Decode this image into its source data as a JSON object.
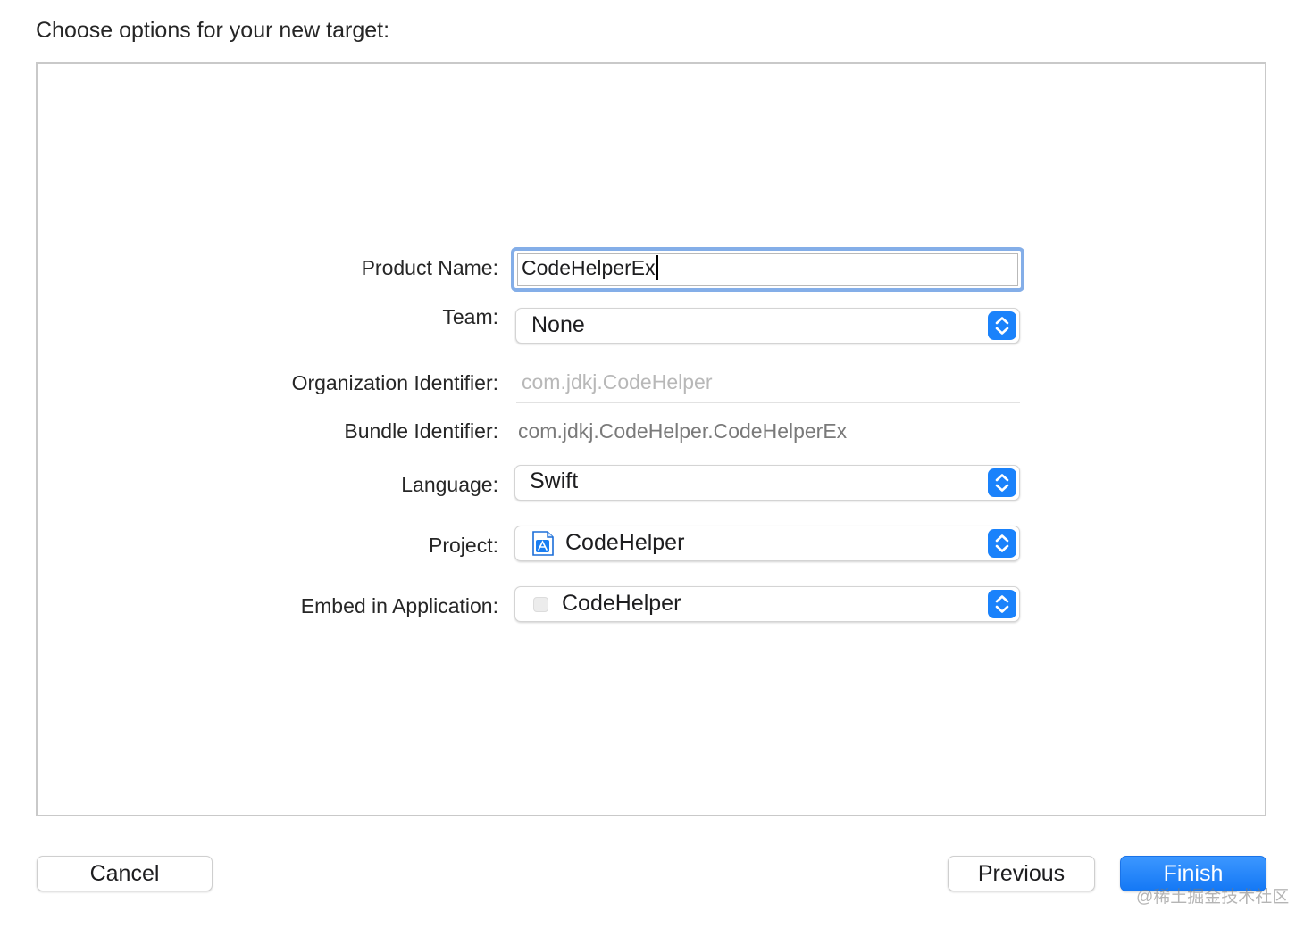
{
  "dialog": {
    "heading": "Choose options for your new target:"
  },
  "form": {
    "product_name": {
      "label": "Product Name:",
      "value": "CodeHelperEx"
    },
    "team": {
      "label": "Team:",
      "value": "None"
    },
    "organization_identifier": {
      "label": "Organization Identifier:",
      "placeholder": "com.jdkj.CodeHelper"
    },
    "bundle_identifier": {
      "label": "Bundle Identifier:",
      "value": "com.jdkj.CodeHelper.CodeHelperEx"
    },
    "language": {
      "label": "Language:",
      "value": "Swift"
    },
    "project": {
      "label": "Project:",
      "value": "CodeHelper",
      "icon": "xcode-project-icon"
    },
    "embed_in_application": {
      "label": "Embed in Application:",
      "value": "CodeHelper",
      "icon": "app-icon"
    }
  },
  "buttons": {
    "cancel": "Cancel",
    "previous": "Previous",
    "finish": "Finish"
  },
  "watermark": "@稀土掘金技术社区",
  "colors": {
    "accent": "#1a82fb",
    "focus_ring": "#84aee8",
    "panel_border": "#c9c9c9"
  }
}
